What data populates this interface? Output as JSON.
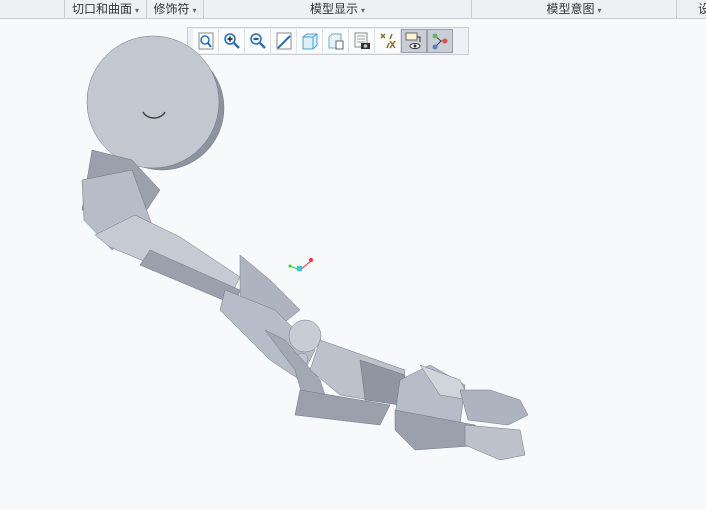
{
  "ribbon": {
    "groups": [
      {
        "label": "",
        "arrow": "▾"
      },
      {
        "label": "切口和曲面",
        "arrow": "▾"
      },
      {
        "label": "修饰符",
        "arrow": "▾"
      },
      {
        "label": "模型显示",
        "arrow": "▾"
      },
      {
        "label": "模型意图",
        "arrow": "▾"
      },
      {
        "label": "设"
      }
    ]
  },
  "toolbar": {
    "buttons": [
      "refit",
      "zoom-in",
      "zoom-out",
      "repaint",
      "display-style",
      "saved-orientations",
      "view-manager",
      "datum-display-filters",
      "spin-center",
      "annotation-display"
    ]
  },
  "colors": {
    "part": "#b7bdc8",
    "part_dark": "#8d94a1",
    "part_light": "#d3d7de",
    "background": "#f8f9fa"
  }
}
